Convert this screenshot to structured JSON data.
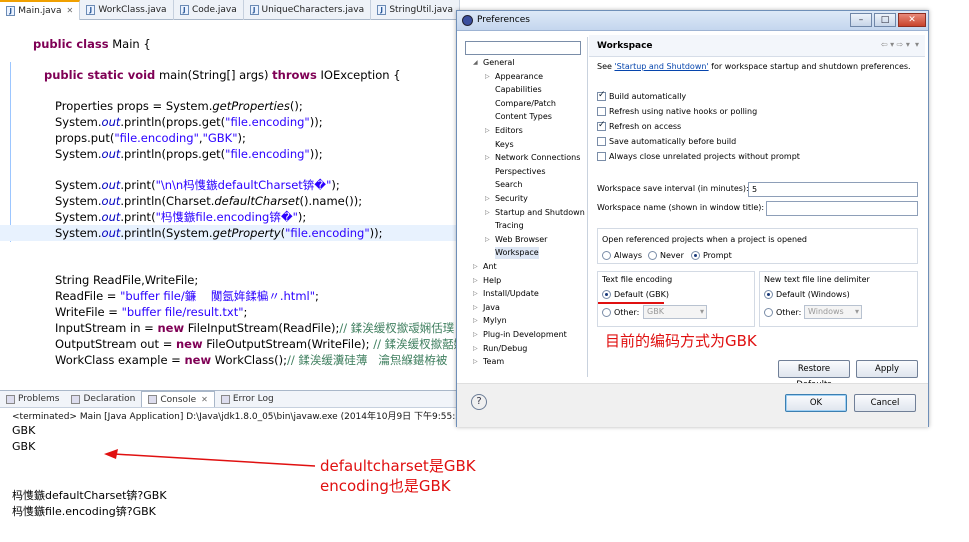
{
  "editor": {
    "tabs": [
      "Main.java",
      "WorkClass.java",
      "Code.java",
      "UniqueCharacters.java",
      "StringUtil.java"
    ],
    "lines": {
      "l1_kw": "public class",
      "l1_rest": " Main {",
      "l2_kw": "public static void",
      "l2_a": " main(String[] args) ",
      "l2_kw2": "throws",
      "l2_b": " IOException {",
      "l3_a": "Properties props = System.",
      "l3_m": "getProperties",
      "l3_b": "();",
      "l4_a": "System.",
      "l4_f": "out",
      "l4_b": ".println(props.get(",
      "l4_s": "\"file.encoding\"",
      "l4_c": "));",
      "l5_a": "props.put(",
      "l5_s1": "\"file.encoding\"",
      "l5_b": ",",
      "l5_s2": "\"GBK\"",
      "l5_c": ");",
      "l6_a": "System.",
      "l6_f": "out",
      "l6_b": ".println(props.get(",
      "l6_s": "\"file.encoding\"",
      "l6_c": "));",
      "l7_a": "System.",
      "l7_f": "out",
      "l7_b": ".print(",
      "l7_s": "\"\\n\\n杩愯鏃defaultCharset锛�\"",
      "l7_c": ");",
      "l8_a": "System.",
      "l8_f": "out",
      "l8_b": ".println(Charset.",
      "l8_m": "defaultCharset",
      "l8_c": "().name());",
      "l9_a": "System.",
      "l9_f": "out",
      "l9_b": ".print(",
      "l9_s": "\"杩愯鏃file.encoding锛�\"",
      "l9_c": ");",
      "l10_a": "System.",
      "l10_f": "out",
      "l10_b": ".println(System.",
      "l10_m": "getProperty",
      "l10_c": "(",
      "l10_s": "\"file.encoding\"",
      "l10_d": "));",
      "l11": "String ReadFile,WriteFile;",
      "l12_a": "ReadFile = ",
      "l12_s": "\"buffer file/鐮    闃氬姩鍒楄〃.html\"",
      "l12_b": ";",
      "l13_a": "WriteFile = ",
      "l13_s": "\"buffer file/result.txt\"",
      "l13_b": ";",
      "l14_a": "InputStream in = ",
      "l14_kw": "new",
      "l14_b": " FileInputStream(ReadFile);",
      "l14_c": "// 鍒涘缓杈撳叆娴佸璞",
      "l15_a": "OutputStream out = ",
      "l15_kw": "new",
      "l15_b": " FileOutputStream(WriteFile);",
      "l15_c": " // 鍒涘缓杈撳嚭娴",
      "l16_a": "WorkClass example = ",
      "l16_kw": "new",
      "l16_b": " WorkClass();",
      "l16_c": "// 鍒涘缓瀵硅薄   瀹炰緥鍖栫被"
    }
  },
  "console": {
    "tabs": [
      "Problems",
      "Declaration",
      "Console",
      "Error Log"
    ],
    "terminated": "<terminated> Main [Java Application] D:\\Java\\jdk1.8.0_05\\bin\\javaw.exe (2014年10月9日 下午9:55:31)",
    "out1": "GBK",
    "out2": "GBK",
    "out3": "杩愯鏃defaultCharset锛?GBK",
    "out4": "杩愯鏃file.encoding锛?GBK"
  },
  "annotations": {
    "console_note1": "defaultcharset是GBK",
    "console_note2": "encoding也是GBK",
    "dialog_note": "目前的编码方式为GBK"
  },
  "dialog": {
    "title": "Preferences",
    "tree": [
      "General",
      "Appearance",
      "Capabilities",
      "Compare/Patch",
      "Content Types",
      "Editors",
      "Keys",
      "Network Connections",
      "Perspectives",
      "Search",
      "Security",
      "Startup and Shutdown",
      "Tracing",
      "Web Browser",
      "Workspace",
      "Ant",
      "Help",
      "Install/Update",
      "Java",
      "Mylyn",
      "Plug-in Development",
      "Run/Debug",
      "Team"
    ],
    "page_title": "Workspace",
    "see_prefix": "See ",
    "see_link": "'Startup and Shutdown'",
    "see_suffix": " for workspace startup and shutdown preferences.",
    "checks": [
      {
        "label": "Build automatically",
        "checked": true
      },
      {
        "label": "Refresh using native hooks or polling",
        "checked": false
      },
      {
        "label": "Refresh on access",
        "checked": true
      },
      {
        "label": "Save automatically before build",
        "checked": false
      },
      {
        "label": "Always close unrelated projects without prompt",
        "checked": false
      }
    ],
    "save_interval_label": "Workspace save interval (in minutes):",
    "save_interval_value": "5",
    "ws_name_label": "Workspace name (shown in window title):",
    "ws_name_value": "",
    "open_ref_label": "Open referenced projects when a project is opened",
    "open_ref_options": [
      "Always",
      "Never",
      "Prompt"
    ],
    "open_ref_selected": "Prompt",
    "text_encoding_label": "Text file encoding",
    "enc_default": "Default (GBK)",
    "enc_other": "Other:",
    "enc_other_value": "GBK",
    "delim_label": "New text file line delimiter",
    "delim_default": "Default (Windows)",
    "delim_other": "Other:",
    "delim_other_value": "Windows",
    "restore_defaults": "Restore Defaults",
    "apply": "Apply",
    "ok": "OK",
    "cancel": "Cancel",
    "help_glyph": "?"
  }
}
